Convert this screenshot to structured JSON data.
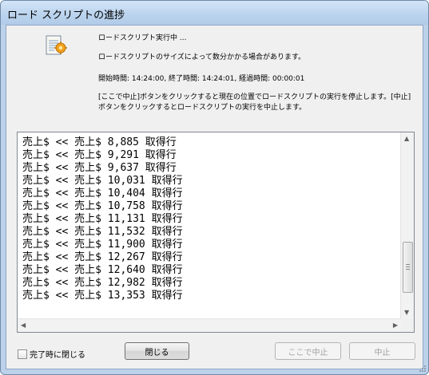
{
  "window": {
    "title": "ロード スクリプトの進捗"
  },
  "status": {
    "running": "ロードスクリプト実行中 ...",
    "note": "ロードスクリプトのサイズによって数分かかる場合があります。",
    "times": "開始時間: 14:24:00, 終了時間: 14:24:01, 経過時間: 00:00:01",
    "help": "[ここで中止]ボタンをクリックすると現在の位置でロードスクリプトの実行を停止します。[中止]ボタンをクリックするとロードスクリプトの実行を中止します。"
  },
  "log": {
    "lines": [
      "売上$ << 売上$ 8,885 取得行",
      "売上$ << 売上$ 9,291 取得行",
      "売上$ << 売上$ 9,637 取得行",
      "売上$ << 売上$ 10,031 取得行",
      "売上$ << 売上$ 10,404 取得行",
      "売上$ << 売上$ 10,758 取得行",
      "売上$ << 売上$ 11,131 取得行",
      "売上$ << 売上$ 11,532 取得行",
      "売上$ << 売上$ 11,900 取得行",
      "売上$ << 売上$ 12,267 取得行",
      "売上$ << 売上$ 12,640 取得行",
      "売上$ << 売上$ 12,982 取得行",
      "売上$ << 売上$ 13,353 取得行"
    ]
  },
  "footer": {
    "close_on_finish_label": "完了時に閉じる",
    "close_on_finish_checked": false,
    "close_button": "閉じる",
    "stop_here_button": "ここで中止",
    "abort_button": "中止"
  }
}
